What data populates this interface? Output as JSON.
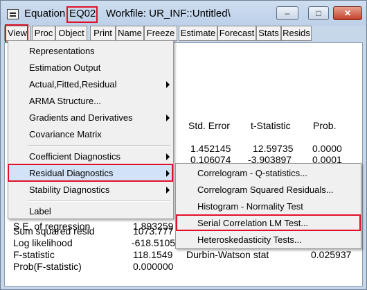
{
  "window": {
    "title_prefix": "Equation",
    "object_name": "EQ02",
    "workfile": "Workfile: UR_INF::Untitled\\",
    "minimize": "–",
    "maximize": "□",
    "close": "✕"
  },
  "toolbar": [
    "View",
    "Proc",
    "Object",
    "Print",
    "Name",
    "Freeze",
    "Estimate",
    "Forecast",
    "Stats",
    "Resids"
  ],
  "output": {
    "col_headers": [
      "Std. Error",
      "t-Statistic",
      "Prob."
    ],
    "rows": [
      {
        "std_error": "1.452145",
        "t_stat": "12.59735",
        "prob": "0.0000"
      },
      {
        "std_error": "0.106074",
        "t_stat": "-3.903897",
        "prob": "0.0001"
      }
    ],
    "partial_label": "S.E. of regression",
    "partial_value": "1.893259",
    "stats": [
      {
        "label": "Sum squared resid",
        "value": "1073.777"
      },
      {
        "label": "Log likelihood",
        "value": "-618.5105"
      },
      {
        "label": "F-statistic",
        "value": "118.1549"
      },
      {
        "label": "Prob(F-statistic)",
        "value": "0.000000"
      }
    ],
    "dw_label": "Durbin-Watson stat",
    "dw_value": "0.025937"
  },
  "view_menu": [
    "Representations",
    "Estimation Output",
    "Actual,Fitted,Residual",
    "ARMA Structure...",
    "Gradients and Derivatives",
    "Covariance Matrix",
    "Coefficient Diagnostics",
    "Residual Diagnostics",
    "Stability Diagnostics",
    "Label"
  ],
  "residual_submenu": [
    "Correlogram - Q-statistics...",
    "Correlogram Squared Residuals...",
    "Histogram - Normality Test",
    "Serial Correlation LM Test...",
    "Heteroskedasticity Tests..."
  ],
  "colors": {
    "highlight_box": "#e0102a",
    "menu_selection": "#d3e3f7"
  }
}
